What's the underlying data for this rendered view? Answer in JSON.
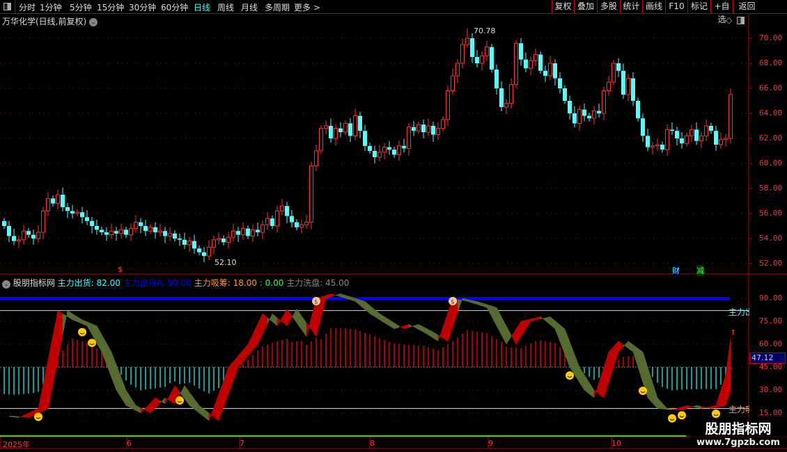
{
  "toolbar": {
    "periods": [
      "分时",
      "1分钟",
      "5分钟",
      "15分钟",
      "30分钟",
      "60分钟",
      "日线",
      "周线",
      "月线",
      "多周期",
      "更多 >"
    ],
    "active": "日线",
    "right_buttons": [
      "复权",
      "叠加",
      "多股",
      "统计",
      "画线",
      "F10",
      "标记",
      "+自选",
      "返回"
    ]
  },
  "stock": {
    "title": "万华化学(日线,前复权)"
  },
  "price_chart": {
    "high_label": "70.78",
    "low_label": "52.10",
    "axis_ticks": [
      70,
      68,
      66,
      64,
      62,
      60,
      58,
      56,
      54,
      52
    ],
    "closes": [
      55,
      54.2,
      53.8,
      53.9,
      54.6,
      54.3,
      54.0,
      54.5,
      56.2,
      57.2,
      56.8,
      57.5,
      56.5,
      56.2,
      56.0,
      56.1,
      55.7,
      55.4,
      55.0,
      54.7,
      54.5,
      54.3,
      54.6,
      54.4,
      54.7,
      54.3,
      54.8,
      55.3,
      55.0,
      54.6,
      54.9,
      54.5,
      54.6,
      54.2,
      54.4,
      54.0,
      53.9,
      53.5,
      53.8,
      53.2,
      52.9,
      52.6,
      53.3,
      53.9,
      54.0,
      53.7,
      54.1,
      54.6,
      54.3,
      54.8,
      54.2,
      54.7,
      54.5,
      55.1,
      55.6,
      55.0,
      56.2,
      56.6,
      55.8,
      55.3,
      54.9,
      55.1,
      55.3,
      59.8,
      61.0,
      62.8,
      63.0,
      62.0,
      62.8,
      62.5,
      63.2,
      62.2,
      63.8,
      62.6,
      61.4,
      61.0,
      60.5,
      60.9,
      61.3,
      61.1,
      60.7,
      61.4,
      61.2,
      62.9,
      62.6,
      63.1,
      62.5,
      63.0,
      62.3,
      62.8,
      63.5,
      65.8,
      67.0,
      68.0,
      69.5,
      70.0,
      68.5,
      68.0,
      68.6,
      69.3,
      67.5,
      66.0,
      64.5,
      64.8,
      66.3,
      69.6,
      68.3,
      67.6,
      68.2,
      68.7,
      67.4,
      67.0,
      68.0,
      66.8,
      66.0,
      65.0,
      64.0,
      63.2,
      64.3,
      63.8,
      63.6,
      64.2,
      64.0,
      65.8,
      66.5,
      68.0,
      67.4,
      65.5,
      66.8,
      65.0,
      63.6,
      62.2,
      61.3,
      61.4,
      61.5,
      61.1,
      62.7,
      62.6,
      62.0,
      61.6,
      62.2,
      62.7,
      61.8,
      62.2,
      63.0,
      62.6,
      61.5,
      61.9,
      62.0,
      65.5
    ],
    "markers": {
      "dollar": "$",
      "cai": "财",
      "jian": "减"
    }
  },
  "indicator": {
    "name": "股朋指标网",
    "legend": [
      {
        "label": "主力出货: 82.00",
        "color": "#33ffff"
      },
      {
        "label": "主力出货A: 90.00",
        "color": "#0000ff"
      },
      {
        "label": "主力吸筹: 18.00",
        "color": "#ff9933"
      },
      {
        "label": ": 0.00",
        "color": "#33ff33"
      },
      {
        "label": "主力洗盘: 45.00",
        "color": "#888888"
      }
    ],
    "axis_ticks": [
      90,
      75,
      60,
      45,
      30,
      15
    ],
    "current_value": "47.12",
    "right_label_out": "主力出",
    "right_label_in": "主力吸",
    "levels": {
      "out": 82,
      "outA": 90,
      "in": 18,
      "zero": 0,
      "wash": 45
    },
    "waypoints": [
      [
        0,
        13
      ],
      [
        3,
        12
      ],
      [
        7,
        18
      ],
      [
        11,
        82
      ],
      [
        14,
        76
      ],
      [
        17,
        72
      ],
      [
        20,
        55
      ],
      [
        23,
        30
      ],
      [
        25,
        20
      ],
      [
        28,
        15
      ],
      [
        31,
        25
      ],
      [
        33,
        21
      ],
      [
        35,
        33
      ],
      [
        38,
        20
      ],
      [
        42,
        10
      ],
      [
        46,
        45
      ],
      [
        50,
        60
      ],
      [
        53,
        80
      ],
      [
        56,
        72
      ],
      [
        58,
        83
      ],
      [
        62,
        65
      ],
      [
        64,
        90
      ],
      [
        67,
        93
      ],
      [
        72,
        88
      ],
      [
        75,
        80
      ],
      [
        80,
        70
      ],
      [
        83,
        73
      ],
      [
        86,
        68
      ],
      [
        89,
        62
      ],
      [
        92,
        90
      ],
      [
        95,
        88
      ],
      [
        99,
        84
      ],
      [
        103,
        60
      ],
      [
        106,
        75
      ],
      [
        110,
        78
      ],
      [
        113,
        70
      ],
      [
        116,
        45
      ],
      [
        119,
        30
      ],
      [
        121,
        25
      ],
      [
        124,
        55
      ],
      [
        126,
        62
      ],
      [
        129,
        55
      ],
      [
        132,
        25
      ],
      [
        134,
        18
      ],
      [
        137,
        17
      ],
      [
        140,
        20
      ],
      [
        143,
        18
      ],
      [
        146,
        20
      ],
      [
        148,
        40
      ],
      [
        149,
        64
      ]
    ],
    "smileys": [
      7,
      16,
      18,
      36,
      116,
      131,
      137,
      139,
      146
    ],
    "money_bags": [
      64,
      92
    ]
  },
  "date_axis": [
    "2025年",
    "6",
    "7",
    "8",
    "9",
    "10"
  ],
  "watermark": {
    "title": "股朋指标网",
    "url": "www.7gpzb.com"
  },
  "colors": {
    "up": "#ff3232",
    "down": "#54fcfc",
    "band_up": "#c00000",
    "band_down": "#556b2f"
  }
}
